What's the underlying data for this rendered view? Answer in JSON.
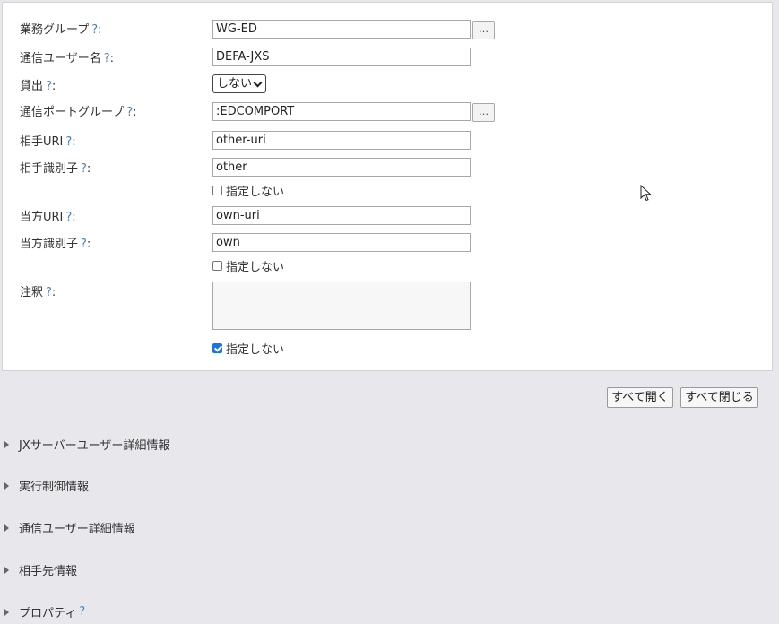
{
  "form": {
    "business_group": {
      "label": "業務グループ",
      "help": "?",
      "value": "WG-ED",
      "browse": "…"
    },
    "comm_user_name": {
      "label": "通信ユーザー名",
      "help": "?",
      "value": "DEFA-JXS"
    },
    "lending": {
      "label": "貸出",
      "help": "?",
      "value": "しない"
    },
    "comm_port_group": {
      "label": "通信ポートグループ",
      "help": "?",
      "value": ":EDCOMPORT",
      "browse": "…"
    },
    "partner_uri": {
      "label": "相手URI",
      "help": "?",
      "value": "other-uri"
    },
    "partner_id": {
      "label": "相手識別子",
      "help": "?",
      "value": "other",
      "checkbox_label": "指定しない",
      "checked": false
    },
    "own_uri": {
      "label": "当方URI",
      "help": "?",
      "value": "own-uri"
    },
    "own_id": {
      "label": "当方識別子",
      "help": "?",
      "value": "own",
      "checkbox_label": "指定しない",
      "checked": false
    },
    "note": {
      "label": "注釈",
      "help": "?",
      "value": "",
      "checkbox_label": "指定しない",
      "checked": true
    },
    "colon": ":"
  },
  "actions": {
    "expand_all": "すべて開く",
    "collapse_all": "すべて閉じる"
  },
  "sections": [
    {
      "label": "JXサーバーユーザー詳細情報"
    },
    {
      "label": "実行制御情報"
    },
    {
      "label": "通信ユーザー詳細情報"
    },
    {
      "label": "相手先情報"
    },
    {
      "label": "プロパティ",
      "help": "?"
    }
  ]
}
